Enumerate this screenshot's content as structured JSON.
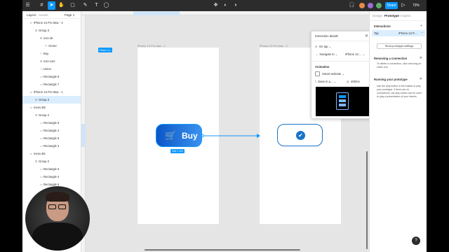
{
  "toolbar": {
    "share": "Share",
    "zoom": "79%"
  },
  "left_panel": {
    "tabs": {
      "layers": "Layers",
      "assets": "Assets",
      "page": "Page 1"
    },
    "layers": [
      {
        "label": "iPhone 13 Pro Max - 2",
        "indent": 1,
        "kind": "frame"
      },
      {
        "label": "Group 3",
        "indent": 2,
        "kind": "group"
      },
      {
        "label": "icon-ok",
        "indent": 3,
        "kind": "group"
      },
      {
        "label": "Vector",
        "indent": 4,
        "kind": "vector"
      },
      {
        "label": "Buy",
        "indent": 3,
        "kind": "text"
      },
      {
        "label": "icon-cart",
        "indent": 3,
        "kind": "group"
      },
      {
        "label": "Union",
        "indent": 3,
        "kind": "union"
      },
      {
        "label": "Rectangle 8",
        "indent": 3,
        "kind": "rect"
      },
      {
        "label": "Rectangle 7",
        "indent": 3,
        "kind": "rect"
      },
      {
        "label": "iPhone 13 Pro Max - 1",
        "indent": 1,
        "kind": "frame"
      },
      {
        "label": "Group 3",
        "indent": 2,
        "kind": "group",
        "selected": true
      },
      {
        "label": "menu-B2",
        "indent": 1,
        "kind": "frame"
      },
      {
        "label": "Group 2",
        "indent": 2,
        "kind": "group"
      },
      {
        "label": "Rectangle 6",
        "indent": 3,
        "kind": "rect"
      },
      {
        "label": "Rectangle 4",
        "indent": 3,
        "kind": "rect"
      },
      {
        "label": "Rectangle 5",
        "indent": 3,
        "kind": "rect"
      },
      {
        "label": "Rectangle 3",
        "indent": 3,
        "kind": "rect"
      },
      {
        "label": "menu-B1",
        "indent": 1,
        "kind": "frame"
      },
      {
        "label": "Group 2",
        "indent": 2,
        "kind": "group"
      },
      {
        "label": "Rectangle 6",
        "indent": 3,
        "kind": "rect"
      },
      {
        "label": "Rectangle 4",
        "indent": 3,
        "kind": "rect"
      },
      {
        "label": "Rectangle 5",
        "indent": 3,
        "kind": "rect"
      }
    ],
    "bottom_layer": "Union"
  },
  "canvas": {
    "frame1_label": "iPhone 13 Pro Max - 1",
    "frame2_label": "iPhone 13 Pro Max - 2",
    "flow_tag": "Flow 1",
    "buy_label": "Buy",
    "size_tag": "246 × 120"
  },
  "interaction_popup": {
    "title": "Interaction details",
    "trigger": "On tap",
    "action": "Navigate to",
    "destination": "iPhone 13 ...",
    "animation_heading": "Animation",
    "animation_type": "Smart animate",
    "easing": "Ease in a...",
    "duration": "400ms"
  },
  "right_panel": {
    "tabs": {
      "design": "Design",
      "prototype": "Prototype",
      "inspect": "Inspect"
    },
    "interactions_heading": "Interactions",
    "tap_label": "Tap",
    "tap_target": "iPhone 13 P...",
    "prototype_settings_button": "Show prototype settings",
    "removing_heading": "Removing a connection",
    "removing_text": "To delete a connection, click and drag on either end",
    "running_heading": "Running your prototype",
    "running_text": "Use the play button in the toolbar to play your prototype. If there are no connections, the play button can be used to play a presentation of your frames."
  },
  "colors": {
    "accent": "#0d99ff",
    "toolbar_bg": "#2c2c2c",
    "canvas_bg": "#e5e5e5",
    "button_dark": "#0b56c8",
    "button_light": "#3a92ee"
  }
}
